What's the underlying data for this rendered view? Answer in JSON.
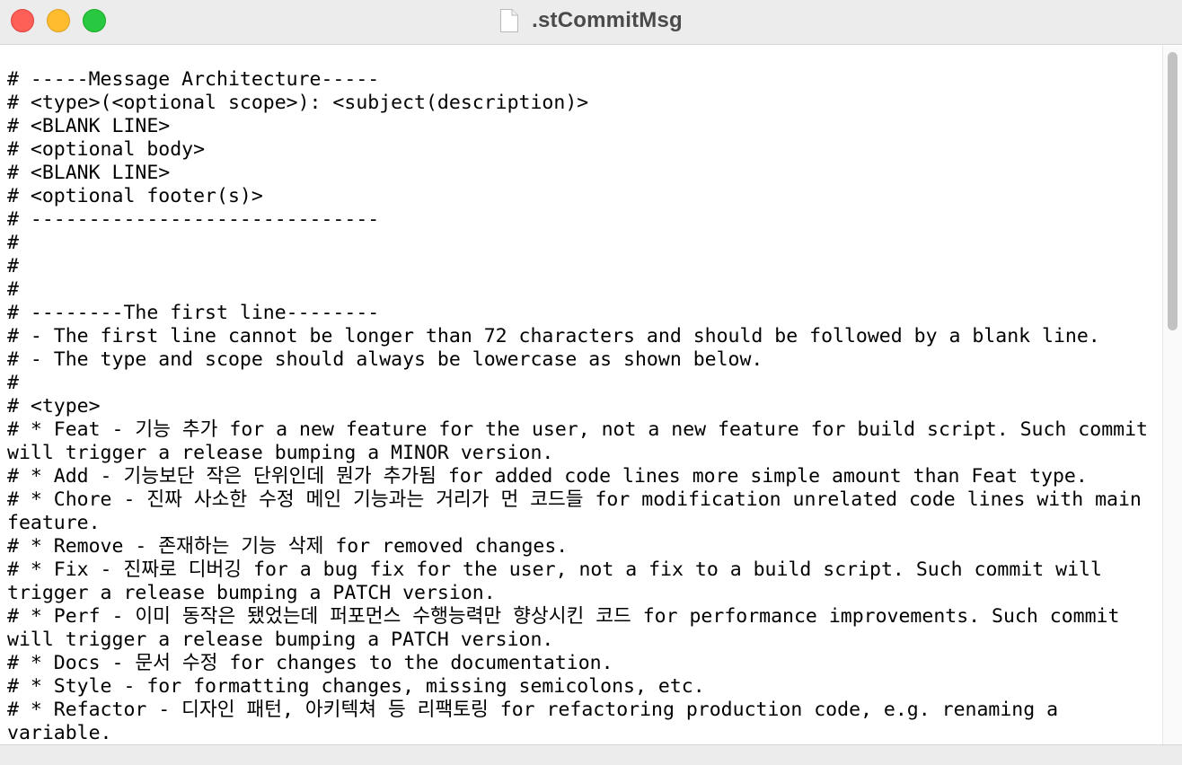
{
  "window": {
    "title": ".stCommitMsg",
    "icons": {
      "close": "close-circle-icon",
      "minimize": "minimize-circle-icon",
      "zoom": "zoom-circle-icon",
      "document": "document-icon"
    },
    "colors": {
      "close": "#fe5f57",
      "minimize": "#febc2e",
      "zoom": "#28c840"
    }
  },
  "editor": {
    "lines": [
      "# -----Message Architecture-----",
      "# <type>(<optional scope>): <subject(description)>",
      "# <BLANK LINE>",
      "# <optional body>",
      "# <BLANK LINE>",
      "# <optional footer(s)>",
      "# ------------------------------",
      "#",
      "#",
      "#",
      "# --------The first line--------",
      "# - The first line cannot be longer than 72 characters and should be followed by a blank line.",
      "# - The type and scope should always be lowercase as shown below.",
      "#",
      "# <type>",
      "# * Feat - 기능 추가 for a new feature for the user, not a new feature for build script. Such commit will trigger a release bumping a MINOR version.",
      "# * Add - 기능보단 작은 단위인데 뭔가 추가됨 for added code lines more simple amount than Feat type.",
      "# * Chore - 진짜 사소한 수정 메인 기능과는 거리가 먼 코드들 for modification unrelated code lines with main feature.",
      "# * Remove - 존재하는 기능 삭제 for removed changes.",
      "# * Fix - 진짜로 디버깅 for a bug fix for the user, not a fix to a build script. Such commit will trigger a release bumping a PATCH version.",
      "# * Perf - 이미 동작은 됐었는데 퍼포먼스 수행능력만 향상시킨 코드 for performance improvements. Such commit will trigger a release bumping a PATCH version.",
      "# * Docs - 문서 수정 for changes to the documentation.",
      "# * Style - for formatting changes, missing semicolons, etc.",
      "# * Refactor - 디자인 패턴, 아키텍쳐 등 리팩토링 for refactoring production code, e.g. renaming a variable."
    ]
  },
  "scrollbar": {
    "scroll_position": 0.0,
    "visible_fraction": 0.4
  }
}
